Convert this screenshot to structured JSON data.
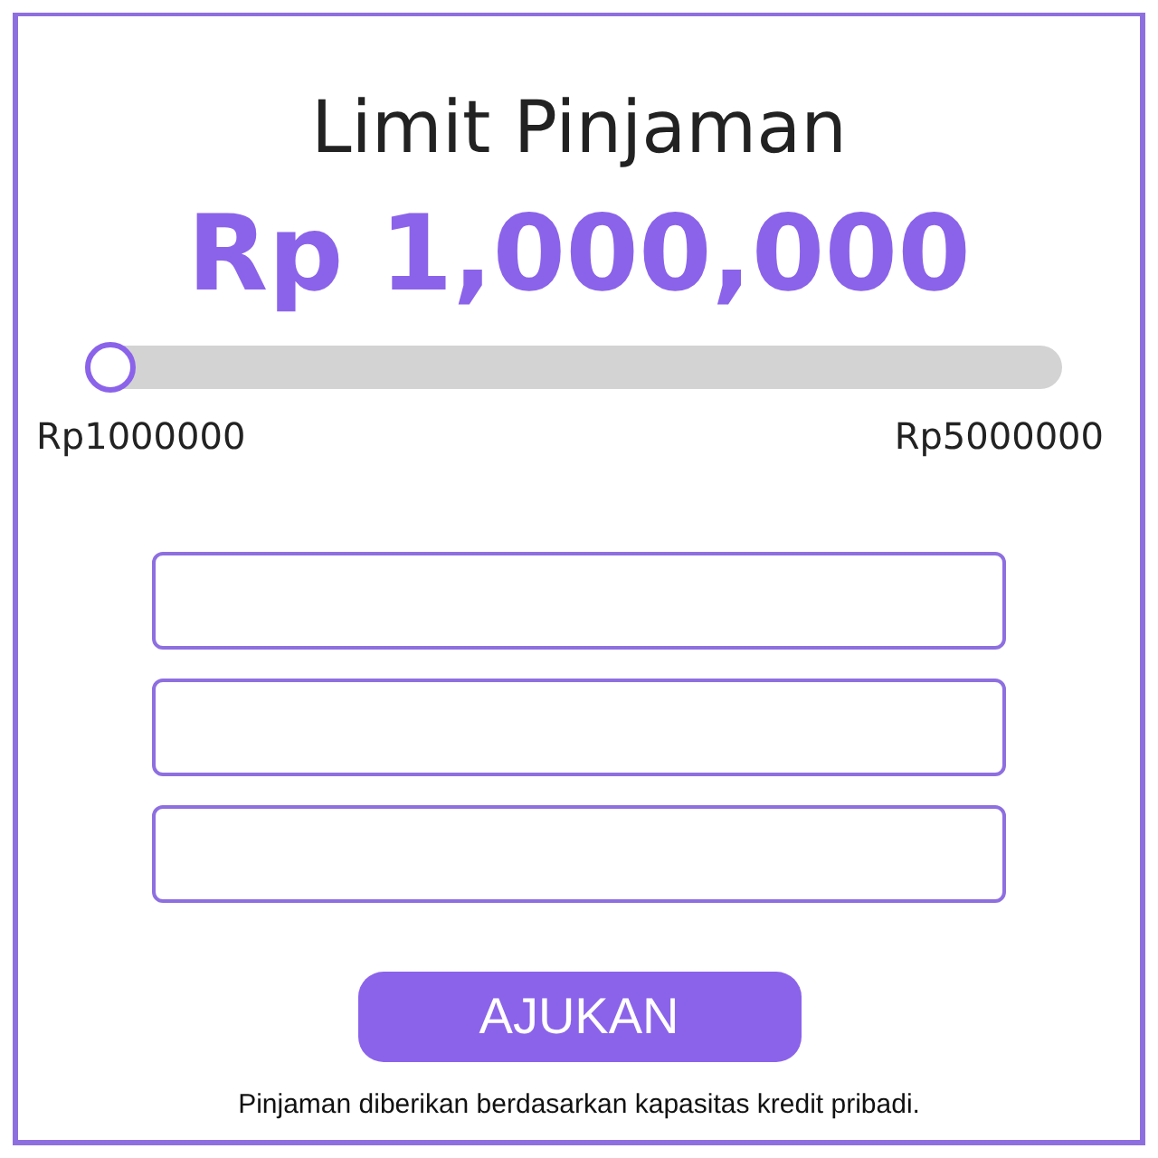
{
  "title": "Limit Pinjaman",
  "amount": "Rp 1,000,000",
  "slider": {
    "level": 0,
    "min_label": "Rp1000000",
    "max_label": "Rp5000000"
  },
  "fields": [
    {
      "kind": "input"
    },
    {
      "kind": "input"
    },
    {
      "kind": "input"
    }
  ],
  "button": "AJUKAN",
  "footnote": "Pinjaman diberikan berdasarkan kapasitas kredit pribadi."
}
